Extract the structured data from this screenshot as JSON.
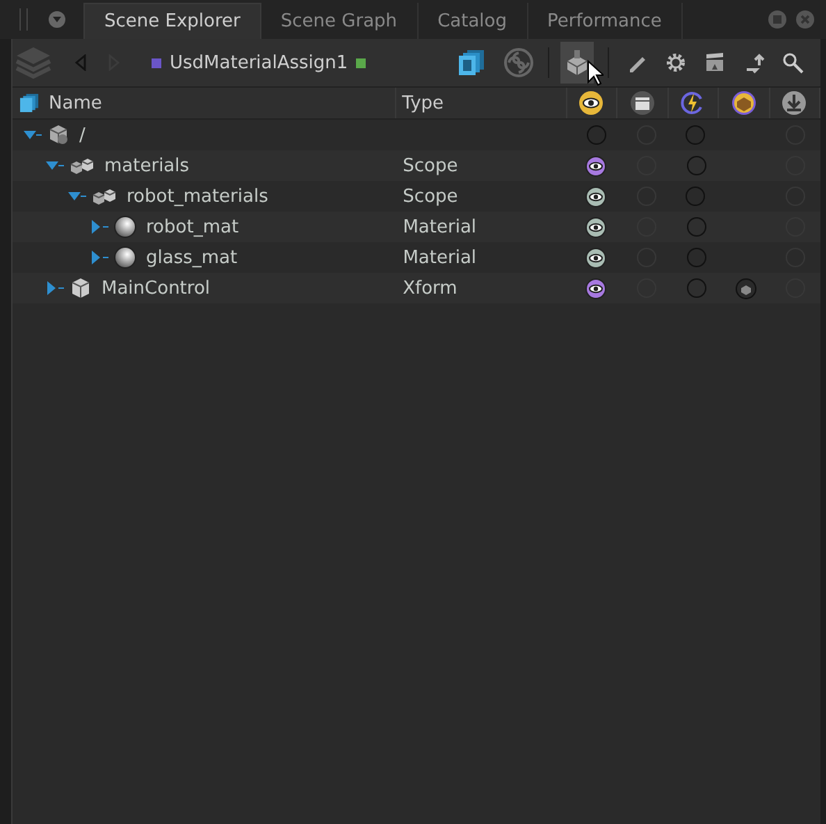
{
  "tabs": [
    {
      "label": "Scene Explorer",
      "selected": true
    },
    {
      "label": "Scene Graph",
      "selected": false
    },
    {
      "label": "Catalog",
      "selected": false
    },
    {
      "label": "Performance",
      "selected": false
    }
  ],
  "toolbar": {
    "node_label": "UsdMaterialAssign1",
    "toolbox_selected": true
  },
  "columns": {
    "name": "Name",
    "type": "Type"
  },
  "tree": [
    {
      "name": "/",
      "kind": "group",
      "expanded": true,
      "visible": false,
      "marker": false,
      "children": [
        {
          "name": "materials",
          "type": "Scope",
          "kind": "scope",
          "expanded": true,
          "visible": true,
          "inherited": false,
          "marker": false,
          "children": [
            {
              "name": "robot_materials",
              "type": "Scope",
              "kind": "scope",
              "expanded": true,
              "visible": true,
              "inherited": true,
              "marker": false,
              "children": [
                {
                  "name": "robot_mat",
                  "type": "Material",
                  "kind": "material",
                  "expanded": false,
                  "visible": true,
                  "inherited": true,
                  "marker": false
                },
                {
                  "name": "glass_mat",
                  "type": "Material",
                  "kind": "material",
                  "expanded": false,
                  "visible": true,
                  "inherited": true,
                  "marker": false
                }
              ]
            }
          ]
        },
        {
          "name": "MainControl",
          "type": "Xform",
          "kind": "xform",
          "expanded": false,
          "visible": true,
          "inherited": false,
          "marker": true
        }
      ]
    }
  ]
}
